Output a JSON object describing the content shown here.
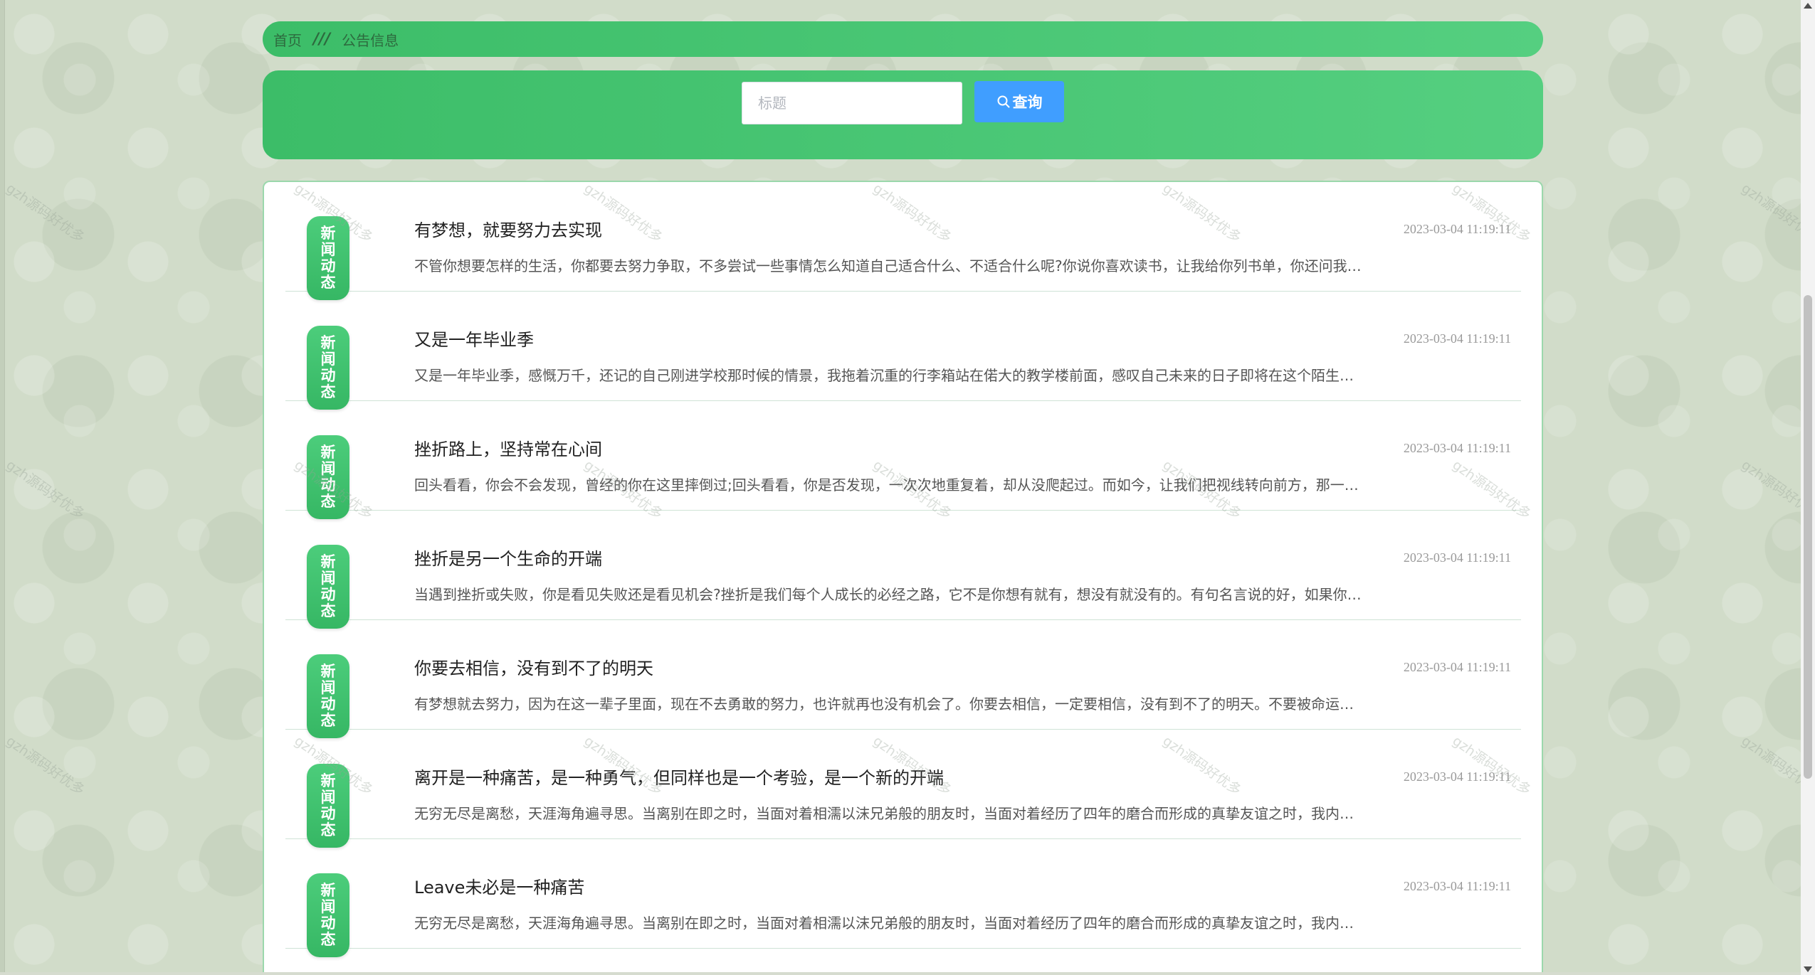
{
  "breadcrumb": {
    "home": "首页",
    "separator": "///",
    "current": "公告信息"
  },
  "search": {
    "placeholder": "标题",
    "value": "",
    "button_label": "查询",
    "button_icon": "search-icon"
  },
  "news": {
    "tag_chars": [
      "新",
      "闻",
      "动",
      "态"
    ],
    "items": [
      {
        "title": "有梦想，就要努力去实现",
        "date": "2023-03-04 11:19:11",
        "summary": "不管你想要怎样的生活，你都要去努力争取，不多尝试一些事情怎么知道自己适合什么、不适合什么呢?你说你喜欢读书，让我给你列书单，你还问我…"
      },
      {
        "title": "又是一年毕业季",
        "date": "2023-03-04 11:19:11",
        "summary": "又是一年毕业季，感慨万千，还记的自己刚进学校那时候的情景，我拖着沉重的行李箱站在偌大的教学楼前面，感叹自己未来的日子即将在这个陌生…"
      },
      {
        "title": "挫折路上，坚持常在心间",
        "date": "2023-03-04 11:19:11",
        "summary": "回头看看，你会不会发现，曾经的你在这里摔倒过;回头看看，你是否发现，一次次地重复着，却从没爬起过。而如今，让我们把视线转向前方，那一…"
      },
      {
        "title": "挫折是另一个生命的开端",
        "date": "2023-03-04 11:19:11",
        "summary": "当遇到挫折或失败，你是看见失败还是看见机会?挫折是我们每个人成长的必经之路，它不是你想有就有，想没有就没有的。有句名言说的好，如果你…"
      },
      {
        "title": "你要去相信，没有到不了的明天",
        "date": "2023-03-04 11:19:11",
        "summary": "有梦想就去努力，因为在这一辈子里面，现在不去勇敢的努力，也许就再也没有机会了。你要去相信，一定要相信，没有到不了的明天。不要被命运…"
      },
      {
        "title": "离开是一种痛苦，是一种勇气，但同样也是一个考验，是一个新的开端",
        "date": "2023-03-04 11:19:11",
        "summary": "无穷无尽是离愁，天涯海角遍寻思。当离别在即之时，当面对着相濡以沫兄弟般的朋友时，当面对着经历了四年的磨合而形成的真挚友谊之时，我内…"
      },
      {
        "title": "Leave未必是一种痛苦",
        "date": "2023-03-04 11:19:11",
        "summary": "无穷无尽是离愁，天涯海角遍寻思。当离别在即之时，当面对着相濡以沫兄弟般的朋友时，当面对着经历了四年的磨合而形成的真挚友谊之时，我内…"
      }
    ]
  },
  "watermark": "gzh源码好优多",
  "colors": {
    "accent_green": "#4ccd7b",
    "search_button": "#409eff",
    "page_background": "#d1dcc9"
  }
}
